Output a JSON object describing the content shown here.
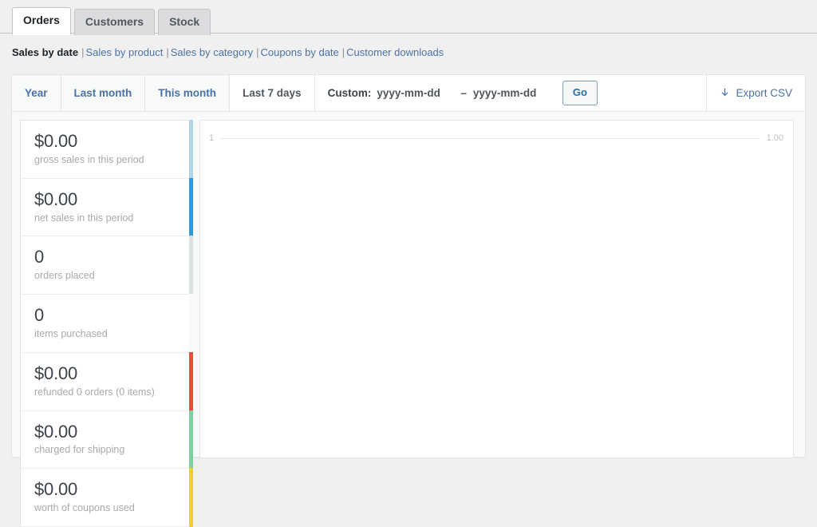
{
  "tabs": [
    {
      "label": "Orders",
      "active": true
    },
    {
      "label": "Customers",
      "active": false
    },
    {
      "label": "Stock",
      "active": false
    }
  ],
  "subnav": {
    "current": "Sales by date",
    "separator": "|",
    "links": [
      "Sales by product",
      "Sales by category",
      "Coupons by date",
      "Customer downloads"
    ]
  },
  "filters": {
    "periods": [
      {
        "label": "Year",
        "active": false
      },
      {
        "label": "Last month",
        "active": false
      },
      {
        "label": "This month",
        "active": false
      },
      {
        "label": "Last 7 days",
        "active": true
      }
    ],
    "custom_label": "Custom:",
    "start_date_placeholder": "yyyy-mm-dd",
    "end_date_placeholder": "yyyy-mm-dd",
    "start_date_value": "",
    "end_date_value": "",
    "range_dash": "–",
    "go_label": "Go",
    "export_label": "Export CSV",
    "export_icon": "download-icon",
    "download_glyph": "↓"
  },
  "stats": [
    {
      "value": "$0.00",
      "label": "gross sales in this period",
      "color": "#b1d4ea"
    },
    {
      "value": "$0.00",
      "label": "net sales in this period",
      "color": "#3498db"
    },
    {
      "value": "0",
      "label": "orders placed",
      "color": "#dbe1e3"
    },
    {
      "value": "0",
      "label": "items purchased",
      "color": "#f8f9f9"
    },
    {
      "value": "$0.00",
      "label": "refunded 0 orders (0 items)",
      "color": "#e74c3c"
    },
    {
      "value": "$0.00",
      "label": "charged for shipping",
      "color": "#7fd19f"
    },
    {
      "value": "$0.00",
      "label": "worth of coupons used",
      "color": "#efd02f"
    }
  ],
  "chart_data": {
    "type": "line",
    "title": "",
    "xlabel": "",
    "ylabel": "",
    "series": [],
    "values": [],
    "categories": [],
    "y_left_tick": "1",
    "y_right_tick": "1.00",
    "ylim": [
      0,
      1
    ],
    "grid": true,
    "legend": "none"
  },
  "colors": {
    "link": "#4a72a8",
    "accent": "#2271b1",
    "page_background": "#f0f0f1",
    "panel_background": "#ffffff",
    "muted_text": "#a7aaad"
  }
}
